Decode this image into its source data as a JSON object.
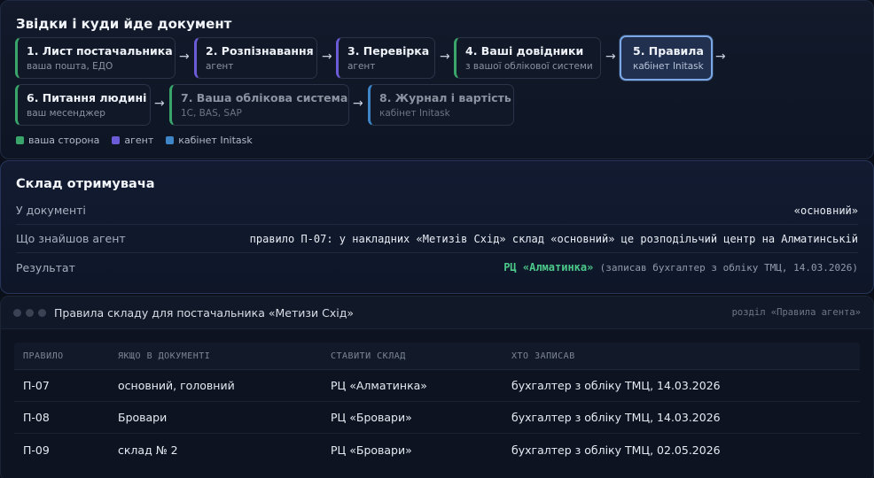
{
  "flow": {
    "title": "Звідки і куди йде документ",
    "steps": [
      {
        "title": "1. Лист постачальника",
        "subtitle": "ваша пошта, ЕДО",
        "side": "yours"
      },
      {
        "title": "2. Розпізнавання",
        "subtitle": "агент",
        "side": "agent"
      },
      {
        "title": "3. Перевірка",
        "subtitle": "агент",
        "side": "agent"
      },
      {
        "title": "4. Ваші довідники",
        "subtitle": "з вашої облікової системи",
        "side": "yours"
      },
      {
        "title": "5. Правила",
        "subtitle": "кабінет Initask",
        "side": "cabinet",
        "active": true
      },
      {
        "title": "6. Питання людині",
        "subtitle": "ваш месенджер",
        "side": "yours"
      },
      {
        "title": "7. Ваша облікова система",
        "subtitle": "1С, BAS, SAP",
        "side": "yours",
        "dimmed": true
      },
      {
        "title": "8. Журнал і вартість",
        "subtitle": "кабінет Initask",
        "side": "cabinet",
        "dimmed": true
      }
    ],
    "arrow": "→",
    "legend": [
      {
        "label": "ваша сторона",
        "color": "#3aa56b"
      },
      {
        "label": "агент",
        "color": "#6b5bd6"
      },
      {
        "label": "кабінет Initask",
        "color": "#3f86c8"
      }
    ]
  },
  "recipient": {
    "title": "Склад отримувача",
    "rows": [
      {
        "label": "У документі",
        "value": "«основний»"
      },
      {
        "label": "Що знайшов агент",
        "value": "правило П-07: у накладних «Метизів Схід» склад «основний» це розподільчий центр на Алматинській"
      },
      {
        "label": "Результат",
        "value_highlight": "РЦ «Алматинка»",
        "value_note": "(записав бухгалтер з обліку ТМЦ, 14.03.2026)"
      }
    ]
  },
  "rules": {
    "window_title": "Правила складу для постачальника «Метизи Схід»",
    "section": "розділ «Правила агента»",
    "columns": [
      "ПРАВИЛО",
      "ЯКЩО В ДОКУМЕНТІ",
      "СТАВИТИ СКЛАД",
      "ХТО ЗАПИСАВ"
    ],
    "rows": [
      [
        "П-07",
        "основний, головний",
        "РЦ «Алматинка»",
        "бухгалтер з обліку ТМЦ, 14.03.2026"
      ],
      [
        "П-08",
        "Бровари",
        "РЦ «Бровари»",
        "бухгалтер з обліку ТМЦ, 14.03.2026"
      ],
      [
        "П-09",
        "склад № 2",
        "РЦ «Бровари»",
        "бухгалтер з обліку ТМЦ, 02.05.2026"
      ]
    ]
  }
}
